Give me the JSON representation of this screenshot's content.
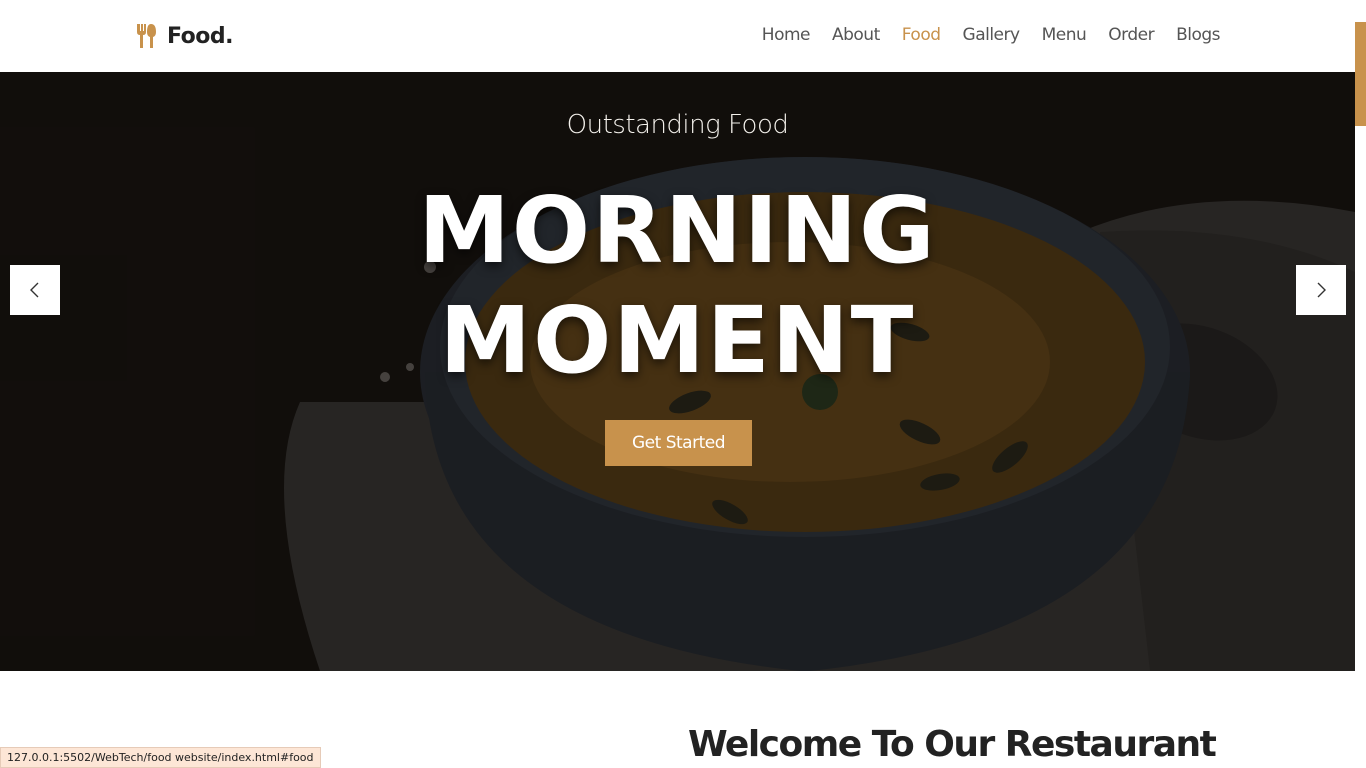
{
  "header": {
    "logo_text": "Food.",
    "logo_icon": "fork-spoon-icon",
    "nav": [
      {
        "label": "Home",
        "active": false
      },
      {
        "label": "About",
        "active": false
      },
      {
        "label": "Food",
        "active": true
      },
      {
        "label": "Gallery",
        "active": false
      },
      {
        "label": "Menu",
        "active": false
      },
      {
        "label": "Order",
        "active": false
      },
      {
        "label": "Blogs",
        "active": false
      }
    ]
  },
  "hero": {
    "subtitle": "Outstanding Food",
    "title_line1": "MORNING",
    "title_line2": "MOMENT",
    "cta_label": "Get Started",
    "prev_icon": "chevron-left-icon",
    "next_icon": "chevron-right-icon"
  },
  "welcome": {
    "heading": "Welcome To Our Restaurant"
  },
  "status": {
    "url": "127.0.0.1:5502/WebTech/food website/index.html#food"
  },
  "colors": {
    "accent": "#c8924c",
    "text_dark": "#222222",
    "nav_text": "#555555",
    "status_bg": "#fde6d6"
  }
}
